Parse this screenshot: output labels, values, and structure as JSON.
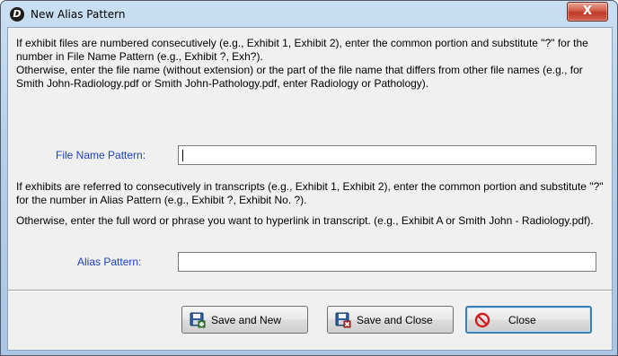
{
  "window": {
    "title": "New Alias Pattern",
    "app_icon_glyph": "D",
    "close_glyph": "X"
  },
  "instructions": {
    "file_name_para1": "If exhibit files are numbered consecutively (e.g., Exhibit 1, Exhibit 2), enter the common portion and substitute \"?\" for the number in File Name Pattern (e.g., Exhibit ?, Exh?).",
    "file_name_para2": "Otherwise, enter the file name (without extension) or the part of the file name that differs from other file names (e.g., for Smith John-Radiology.pdf or Smith John-Pathology.pdf, enter Radiology or Pathology).",
    "alias_para1": "If exhibits are referred to consecutively in transcripts (e.g., Exhibit 1, Exhibit 2), enter the common portion and substitute \"?\" for the number in Alias Pattern (e.g., Exhibit ?, Exhibit No. ?).",
    "alias_para2": "Otherwise, enter the full word or phrase you want to hyperlink in transcript. (e.g., Exhibit A or Smith John - Radiology.pdf)."
  },
  "fields": {
    "file_name_label": "File Name Pattern:",
    "file_name_value": "",
    "alias_label": "Alias Pattern:",
    "alias_value": ""
  },
  "buttons": {
    "save_and_new": "Save and New",
    "save_and_close": "Save and Close",
    "close": "Close"
  },
  "icons": {
    "app": "app-logo-icon",
    "save_new": "save-new-icon",
    "save_close": "save-close-icon",
    "close": "cancel-circle-icon"
  },
  "colors": {
    "label_blue": "#1f3fbf",
    "close_red": "#c0392b",
    "focus_border": "#3c7fb1"
  }
}
